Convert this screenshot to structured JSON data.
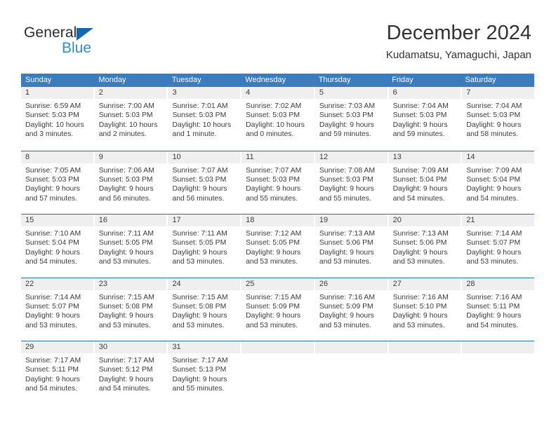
{
  "brand": {
    "name_top": "General",
    "name_bottom": "Blue",
    "triangle_color": "#1268b3",
    "blue_text_color": "#2e8bd4"
  },
  "header": {
    "title": "December 2024",
    "subtitle": "Kudamatsu, Yamaguchi, Japan"
  },
  "theme": {
    "header_bar_color": "#3a7cbe",
    "row_divider_color": "#2f6ba6",
    "daynum_band_color": "#efefef",
    "text_color": "#3b3b3b"
  },
  "weekdays": [
    "Sunday",
    "Monday",
    "Tuesday",
    "Wednesday",
    "Thursday",
    "Friday",
    "Saturday"
  ],
  "labels": {
    "sunrise_prefix": "Sunrise:",
    "sunset_prefix": "Sunset:",
    "daylight_prefix": "Daylight:"
  },
  "weeks": [
    [
      {
        "day": "1",
        "sunrise": "Sunrise: 6:59 AM",
        "sunset": "Sunset: 5:03 PM",
        "daylight1": "Daylight: 10 hours",
        "daylight2": "and 3 minutes."
      },
      {
        "day": "2",
        "sunrise": "Sunrise: 7:00 AM",
        "sunset": "Sunset: 5:03 PM",
        "daylight1": "Daylight: 10 hours",
        "daylight2": "and 2 minutes."
      },
      {
        "day": "3",
        "sunrise": "Sunrise: 7:01 AM",
        "sunset": "Sunset: 5:03 PM",
        "daylight1": "Daylight: 10 hours",
        "daylight2": "and 1 minute."
      },
      {
        "day": "4",
        "sunrise": "Sunrise: 7:02 AM",
        "sunset": "Sunset: 5:03 PM",
        "daylight1": "Daylight: 10 hours",
        "daylight2": "and 0 minutes."
      },
      {
        "day": "5",
        "sunrise": "Sunrise: 7:03 AM",
        "sunset": "Sunset: 5:03 PM",
        "daylight1": "Daylight: 9 hours",
        "daylight2": "and 59 minutes."
      },
      {
        "day": "6",
        "sunrise": "Sunrise: 7:04 AM",
        "sunset": "Sunset: 5:03 PM",
        "daylight1": "Daylight: 9 hours",
        "daylight2": "and 59 minutes."
      },
      {
        "day": "7",
        "sunrise": "Sunrise: 7:04 AM",
        "sunset": "Sunset: 5:03 PM",
        "daylight1": "Daylight: 9 hours",
        "daylight2": "and 58 minutes."
      }
    ],
    [
      {
        "day": "8",
        "sunrise": "Sunrise: 7:05 AM",
        "sunset": "Sunset: 5:03 PM",
        "daylight1": "Daylight: 9 hours",
        "daylight2": "and 57 minutes."
      },
      {
        "day": "9",
        "sunrise": "Sunrise: 7:06 AM",
        "sunset": "Sunset: 5:03 PM",
        "daylight1": "Daylight: 9 hours",
        "daylight2": "and 56 minutes."
      },
      {
        "day": "10",
        "sunrise": "Sunrise: 7:07 AM",
        "sunset": "Sunset: 5:03 PM",
        "daylight1": "Daylight: 9 hours",
        "daylight2": "and 56 minutes."
      },
      {
        "day": "11",
        "sunrise": "Sunrise: 7:07 AM",
        "sunset": "Sunset: 5:03 PM",
        "daylight1": "Daylight: 9 hours",
        "daylight2": "and 55 minutes."
      },
      {
        "day": "12",
        "sunrise": "Sunrise: 7:08 AM",
        "sunset": "Sunset: 5:03 PM",
        "daylight1": "Daylight: 9 hours",
        "daylight2": "and 55 minutes."
      },
      {
        "day": "13",
        "sunrise": "Sunrise: 7:09 AM",
        "sunset": "Sunset: 5:04 PM",
        "daylight1": "Daylight: 9 hours",
        "daylight2": "and 54 minutes."
      },
      {
        "day": "14",
        "sunrise": "Sunrise: 7:09 AM",
        "sunset": "Sunset: 5:04 PM",
        "daylight1": "Daylight: 9 hours",
        "daylight2": "and 54 minutes."
      }
    ],
    [
      {
        "day": "15",
        "sunrise": "Sunrise: 7:10 AM",
        "sunset": "Sunset: 5:04 PM",
        "daylight1": "Daylight: 9 hours",
        "daylight2": "and 54 minutes."
      },
      {
        "day": "16",
        "sunrise": "Sunrise: 7:11 AM",
        "sunset": "Sunset: 5:05 PM",
        "daylight1": "Daylight: 9 hours",
        "daylight2": "and 53 minutes."
      },
      {
        "day": "17",
        "sunrise": "Sunrise: 7:11 AM",
        "sunset": "Sunset: 5:05 PM",
        "daylight1": "Daylight: 9 hours",
        "daylight2": "and 53 minutes."
      },
      {
        "day": "18",
        "sunrise": "Sunrise: 7:12 AM",
        "sunset": "Sunset: 5:05 PM",
        "daylight1": "Daylight: 9 hours",
        "daylight2": "and 53 minutes."
      },
      {
        "day": "19",
        "sunrise": "Sunrise: 7:13 AM",
        "sunset": "Sunset: 5:06 PM",
        "daylight1": "Daylight: 9 hours",
        "daylight2": "and 53 minutes."
      },
      {
        "day": "20",
        "sunrise": "Sunrise: 7:13 AM",
        "sunset": "Sunset: 5:06 PM",
        "daylight1": "Daylight: 9 hours",
        "daylight2": "and 53 minutes."
      },
      {
        "day": "21",
        "sunrise": "Sunrise: 7:14 AM",
        "sunset": "Sunset: 5:07 PM",
        "daylight1": "Daylight: 9 hours",
        "daylight2": "and 53 minutes."
      }
    ],
    [
      {
        "day": "22",
        "sunrise": "Sunrise: 7:14 AM",
        "sunset": "Sunset: 5:07 PM",
        "daylight1": "Daylight: 9 hours",
        "daylight2": "and 53 minutes."
      },
      {
        "day": "23",
        "sunrise": "Sunrise: 7:15 AM",
        "sunset": "Sunset: 5:08 PM",
        "daylight1": "Daylight: 9 hours",
        "daylight2": "and 53 minutes."
      },
      {
        "day": "24",
        "sunrise": "Sunrise: 7:15 AM",
        "sunset": "Sunset: 5:08 PM",
        "daylight1": "Daylight: 9 hours",
        "daylight2": "and 53 minutes."
      },
      {
        "day": "25",
        "sunrise": "Sunrise: 7:15 AM",
        "sunset": "Sunset: 5:09 PM",
        "daylight1": "Daylight: 9 hours",
        "daylight2": "and 53 minutes."
      },
      {
        "day": "26",
        "sunrise": "Sunrise: 7:16 AM",
        "sunset": "Sunset: 5:09 PM",
        "daylight1": "Daylight: 9 hours",
        "daylight2": "and 53 minutes."
      },
      {
        "day": "27",
        "sunrise": "Sunrise: 7:16 AM",
        "sunset": "Sunset: 5:10 PM",
        "daylight1": "Daylight: 9 hours",
        "daylight2": "and 53 minutes."
      },
      {
        "day": "28",
        "sunrise": "Sunrise: 7:16 AM",
        "sunset": "Sunset: 5:11 PM",
        "daylight1": "Daylight: 9 hours",
        "daylight2": "and 54 minutes."
      }
    ],
    [
      {
        "day": "29",
        "sunrise": "Sunrise: 7:17 AM",
        "sunset": "Sunset: 5:11 PM",
        "daylight1": "Daylight: 9 hours",
        "daylight2": "and 54 minutes."
      },
      {
        "day": "30",
        "sunrise": "Sunrise: 7:17 AM",
        "sunset": "Sunset: 5:12 PM",
        "daylight1": "Daylight: 9 hours",
        "daylight2": "and 54 minutes."
      },
      {
        "day": "31",
        "sunrise": "Sunrise: 7:17 AM",
        "sunset": "Sunset: 5:13 PM",
        "daylight1": "Daylight: 9 hours",
        "daylight2": "and 55 minutes."
      },
      {
        "day": "",
        "sunrise": "",
        "sunset": "",
        "daylight1": "",
        "daylight2": ""
      },
      {
        "day": "",
        "sunrise": "",
        "sunset": "",
        "daylight1": "",
        "daylight2": ""
      },
      {
        "day": "",
        "sunrise": "",
        "sunset": "",
        "daylight1": "",
        "daylight2": ""
      },
      {
        "day": "",
        "sunrise": "",
        "sunset": "",
        "daylight1": "",
        "daylight2": ""
      }
    ]
  ]
}
